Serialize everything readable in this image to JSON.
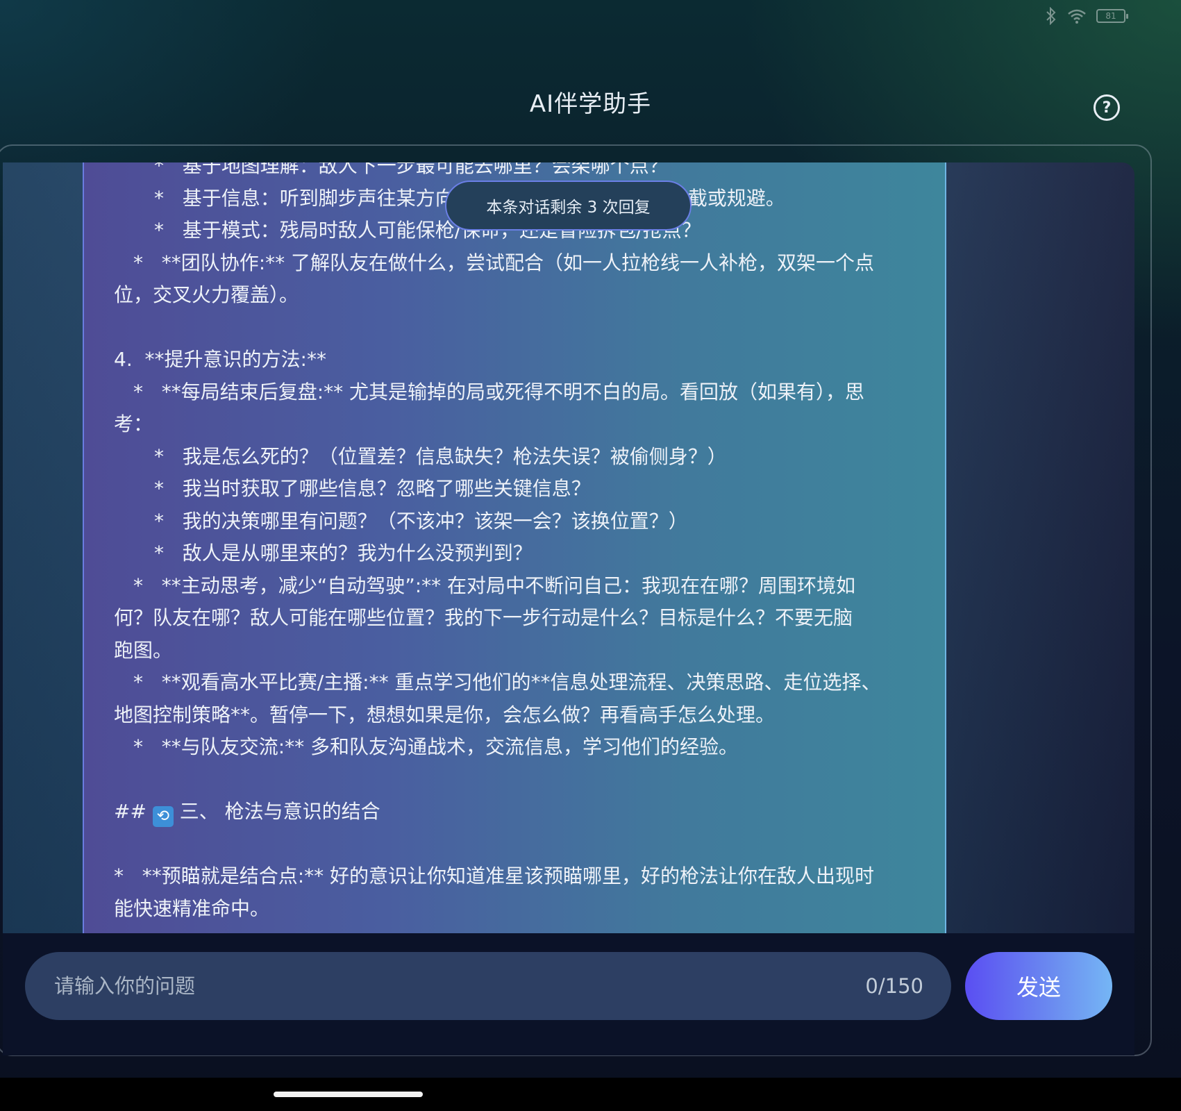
{
  "status_bar": {
    "bluetooth_icon": "bluetooth-icon",
    "wifi_icon": "wifi-icon",
    "battery_level": "81"
  },
  "header": {
    "title": "AI伴学助手",
    "help_icon": "help-circle-icon",
    "help_glyph": "?"
  },
  "toast": {
    "text": "本条对话剩余 3 次回复"
  },
  "message": {
    "lines": [
      {
        "indent": 2,
        "text": "*   基于地图理解：敌人下一步最可能去哪里？会架哪个点？"
      },
      {
        "indent": 2,
        "text": "*   基于信息：听到脚步声往某方向移动，判断其意图，提前拦截或规避。"
      },
      {
        "indent": 2,
        "text": "*   基于模式：残局时敌人可能保枪/保命，还是冒险拆包/抢点？"
      },
      {
        "indent": 1,
        "text": "*   **团队协作:** 了解队友在做什么，尝试配合（如一人拉枪线一人补枪，双架一个点"
      },
      {
        "indent": 0,
        "text": "位，交叉火力覆盖）。"
      },
      {
        "indent": 0,
        "text": ""
      },
      {
        "indent": 0,
        "text": "4.  **提升意识的方法:**"
      },
      {
        "indent": 1,
        "text": "*   **每局结束后复盘:** 尤其是输掉的局或死得不明不白的局。看回放（如果有），思"
      },
      {
        "indent": 0,
        "text": "考："
      },
      {
        "indent": 2,
        "text": "*   我是怎么死的？（位置差？信息缺失？枪法失误？被偷侧身？）"
      },
      {
        "indent": 2,
        "text": "*   我当时获取了哪些信息？忽略了哪些关键信息？"
      },
      {
        "indent": 2,
        "text": "*   我的决策哪里有问题？（不该冲？该架一会？该换位置？）"
      },
      {
        "indent": 2,
        "text": "*   敌人是从哪里来的？我为什么没预判到？"
      },
      {
        "indent": 1,
        "text": "*   **主动思考，减少“自动驾驶”:** 在对局中不断问自己：我现在在哪？周围环境如"
      },
      {
        "indent": 0,
        "text": "何？队友在哪？敌人可能在哪些位置？我的下一步行动是什么？目标是什么？不要无脑"
      },
      {
        "indent": 0,
        "text": "跑图。"
      },
      {
        "indent": 1,
        "text": "*   **观看高水平比赛/主播:** 重点学习他们的**信息处理流程、决策思路、走位选择、"
      },
      {
        "indent": 0,
        "text": "地图控制策略**。暂停一下，想想如果是你，会怎么做？再看高手怎么处理。"
      },
      {
        "indent": 1,
        "text": "*   **与队友交流:** 多和队友沟通战术，交流信息，学习他们的经验。"
      },
      {
        "indent": 0,
        "text": ""
      },
      {
        "indent": 0,
        "text": "## 🔄 三、 枪法与意识的结合",
        "has_emoji": true
      },
      {
        "indent": 0,
        "text": ""
      },
      {
        "indent": 0,
        "text": "*   **预瞄就是结合点:** 好的意识让你知道准星该预瞄哪里，好的枪法让你在敌人出现时"
      },
      {
        "indent": 0,
        "text": "能快速精准命中。"
      }
    ]
  },
  "input": {
    "placeholder": "请输入你的问题",
    "value": "",
    "char_count": "0/150"
  },
  "send_button": {
    "label": "发送"
  }
}
